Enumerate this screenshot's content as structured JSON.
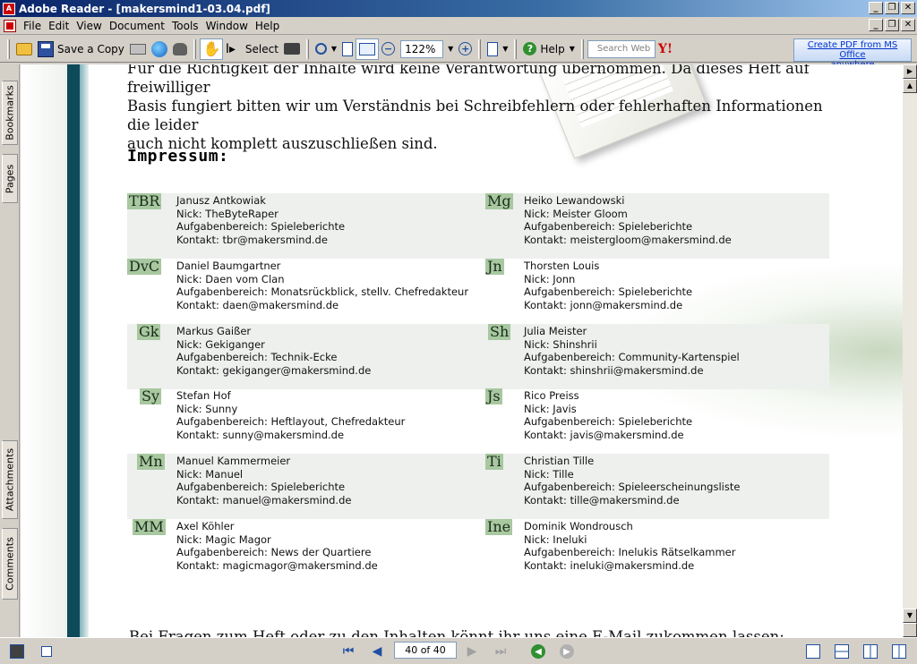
{
  "window": {
    "title": "Adobe Reader - [makersmind1-03.04.pdf]",
    "controls": [
      "_",
      "❐",
      "✕"
    ]
  },
  "menu": {
    "items": [
      "File",
      "Edit",
      "View",
      "Document",
      "Tools",
      "Window",
      "Help"
    ]
  },
  "toolbar": {
    "save_copy_label": "Save a Copy",
    "select_label": "Select",
    "zoom_value": "122%",
    "help_label": "Help",
    "search_placeholder": "Search Web",
    "create_pdf_line1": "Create PDF from MS Office",
    "create_pdf_line2": "anywhere",
    "icons": [
      "open-folder-icon",
      "save-icon",
      "print-icon",
      "email-icon",
      "search-icon",
      "hand-icon",
      "select-text-icon",
      "snapshot-icon",
      "zoom-in-icon",
      "fit-page-icon",
      "fit-width-icon",
      "zoom-out-icon",
      "zoom-in-circle-icon",
      "rotate-icon",
      "help-icon",
      "yahoo-icon"
    ]
  },
  "sidebar": {
    "tabs": [
      "Bookmarks",
      "Pages",
      "Attachments",
      "Comments"
    ]
  },
  "document": {
    "intro_lines": [
      "Für die Richtigkeit der Inhalte wird keine Verantwortung übernommen. Da dieses Heft auf freiwilliger",
      "Basis fungiert bitten wir um Verständnis bei Schreibfehlern oder fehlerhaften Informationen die leider",
      "auch nicht komplett auszuschließen sind."
    ],
    "impressum_title": "Impressum:",
    "staff_rows": [
      [
        {
          "initials": "TBR",
          "name": "Janusz Antkowiak",
          "nick": "Nick: TheByteRaper",
          "area": "Aufgabenbereich: Spieleberichte",
          "contact": "Kontakt: tbr@makersmind.de"
        },
        {
          "initials": "Mg",
          "name": "Heiko Lewandowski",
          "nick": "Nick: Meister Gloom",
          "area": "Aufgabenbereich: Spieleberichte",
          "contact": "Kontakt: meistergloom@makersmind.de"
        }
      ],
      [
        {
          "initials": "DvC",
          "name": "Daniel Baumgartner",
          "nick": "Nick: Daen vom Clan",
          "area": "Aufgabenbereich: Monatsrückblick, stellv. Chefredakteur",
          "contact": "Kontakt: daen@makersmind.de"
        },
        {
          "initials": "Jn",
          "name": "Thorsten Louis",
          "nick": "Nick: Jonn",
          "area": "Aufgabenbereich: Spieleberichte",
          "contact": "Kontakt: jonn@makersmind.de"
        }
      ],
      [
        {
          "initials": "Gk",
          "name": "Markus Gaißer",
          "nick": "Nick: Gekiganger",
          "area": "Aufgabenbereich: Technik-Ecke",
          "contact": "Kontakt: gekiganger@makersmind.de"
        },
        {
          "initials": "Sh",
          "name": "Julia Meister",
          "nick": "Nick: Shinshrii",
          "area": "Aufgabenbereich: Community-Kartenspiel",
          "contact": "Kontakt: shinshrii@makersmind.de"
        }
      ],
      [
        {
          "initials": "Sy",
          "name": "Stefan Hof",
          "nick": "Nick: Sunny",
          "area": "Aufgabenbereich: Heftlayout, Chefredakteur",
          "contact": "Kontakt: sunny@makersmind.de"
        },
        {
          "initials": "Js",
          "name": "Rico Preiss",
          "nick": "Nick: Javis",
          "area": "Aufgabenbereich: Spieleberichte",
          "contact": "Kontakt: javis@makersmind.de"
        }
      ],
      [
        {
          "initials": "Mn",
          "name": "Manuel Kammermeier",
          "nick": "Nick: Manuel",
          "area": "Aufgabenbereich: Spieleberichte",
          "contact": "Kontakt: manuel@makersmind.de"
        },
        {
          "initials": "Ti",
          "name": "Christian Tille",
          "nick": "Nick: Tille",
          "area": "Aufgabenbereich: Spieleerscheinungsliste",
          "contact": "Kontakt: tille@makersmind.de"
        }
      ],
      [
        {
          "initials": "MM",
          "name": "Axel Köhler",
          "nick": "Nick: Magic Magor",
          "area": "Aufgabenbereich: News der Quartiere",
          "contact": "Kontakt: magicmagor@makersmind.de"
        },
        {
          "initials": "Ine",
          "name": "Dominik Wondrousch",
          "nick": "Nick: Ineluki",
          "area": "Aufgabenbereich: Inelukis Rätselkammer",
          "contact": "Kontakt: ineluki@makersmind.de"
        }
      ]
    ],
    "footer_line": "Bei Fragen zum Heft oder zu den Inhalten könnt ihr uns eine E-Mail zukommen lassen:"
  },
  "statusbar": {
    "page_indicator": "40 of 40"
  },
  "colors": {
    "accent_green": "#a8c8a0",
    "stripe_dark": "#0e4a5a",
    "title_blue": "#0a246a"
  }
}
